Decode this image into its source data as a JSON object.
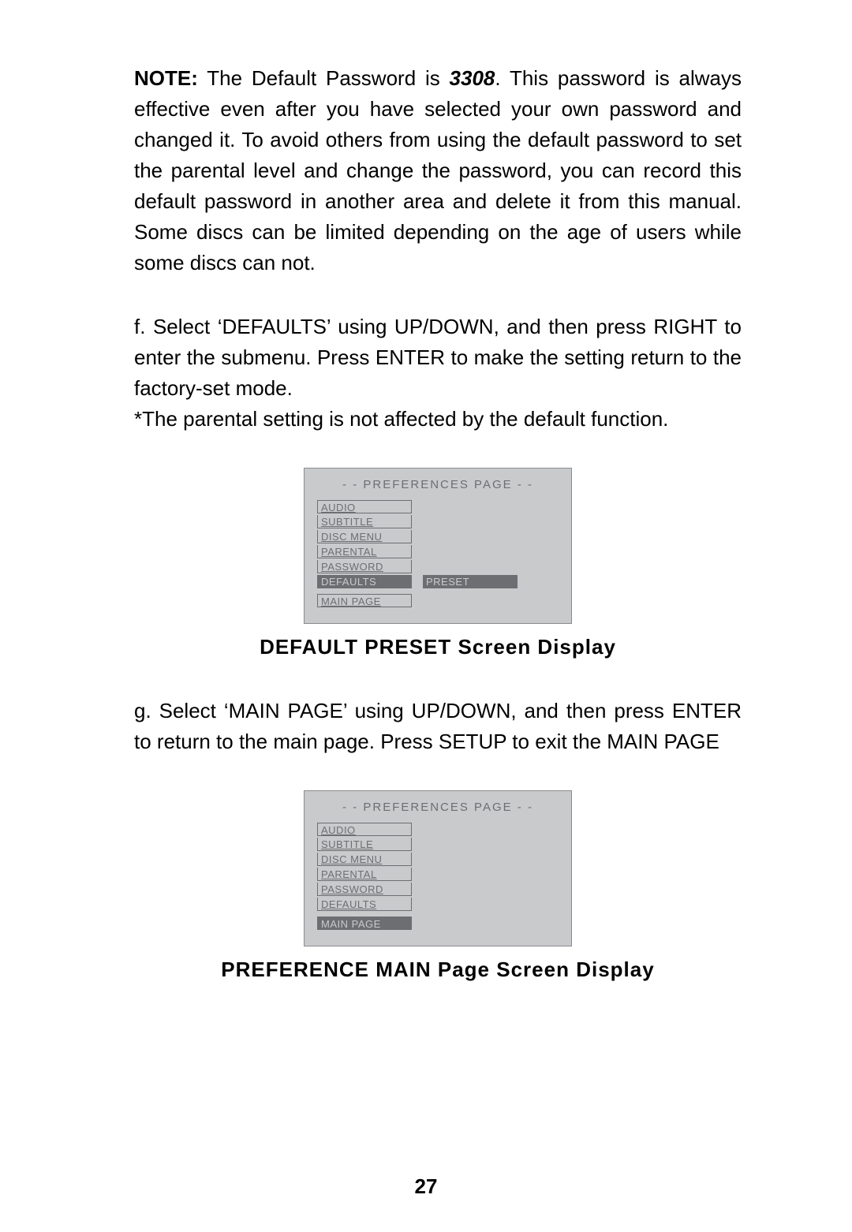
{
  "note": {
    "label": "NOTE:",
    "text_before": " The Default Password is ",
    "password": "3308",
    "text_after": ". This password  is always effective even after  you have selected your own password and changed it.  To avoid others from using the default password  to set the parental level and change the password, you can record  this default password in another area and delete it from this manual. Some discs can be limited depending on the age of users while some discs can not."
  },
  "step_f": "f. Select ‘DEFAULTS’ using UP/DOWN, and then press RIGHT to enter the submenu. Press ENTER to make the setting return to the factory-set mode.\n*The parental setting is not affected by the default function.",
  "osd1": {
    "title": "- -  PREFERENCES PAGE  - -",
    "items": [
      "AUDIO",
      "SUBTITLE",
      "DISC MENU",
      "PARENTAL",
      "PASSWORD",
      "DEFAULTS"
    ],
    "selected_index": 5,
    "value_label": "PRESET",
    "footer": "MAIN PAGE",
    "footer_selected": false
  },
  "caption1": "DEFAULT PRESET Screen Display",
  "step_g": "g. Select ‘MAIN PAGE’ using UP/DOWN, and then press ENTER to return to the main page.  Press SETUP to exit the MAIN PAGE",
  "osd2": {
    "title": "- -  PREFERENCES PAGE  - -",
    "items": [
      "AUDIO",
      "SUBTITLE",
      "DISC MENU",
      "PARENTAL",
      "PASSWORD",
      "DEFAULTS"
    ],
    "selected_index": -1,
    "footer": "MAIN PAGE",
    "footer_selected": true
  },
  "caption2": "PREFERENCE MAIN Page Screen Display",
  "page_number": "27"
}
